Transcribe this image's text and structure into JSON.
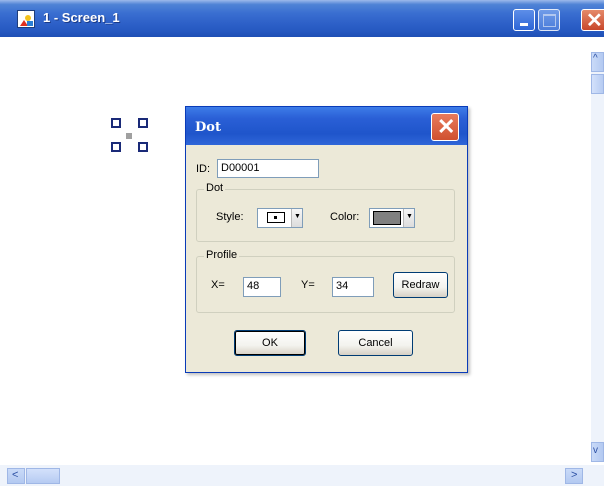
{
  "window": {
    "title": "1 - Screen_1"
  },
  "dialog": {
    "title": "Dot",
    "id_label": "ID:",
    "id_value": "D00001",
    "dot_group": "Dot",
    "style_label": "Style:",
    "color_label": "Color:",
    "color_value": "#808080",
    "profile_group": "Profile",
    "x_label": "X=",
    "x_value": "48",
    "y_label": "Y=",
    "y_value": "34",
    "redraw_label": "Redraw",
    "ok_label": "OK",
    "cancel_label": "Cancel"
  },
  "scroll": {
    "up": "^",
    "down": "v",
    "left": "<",
    "right": ">"
  },
  "colors": {
    "title_bar": "#2a5fd6",
    "close_button": "#d0502f",
    "dialog_face": "#ece9d8"
  }
}
